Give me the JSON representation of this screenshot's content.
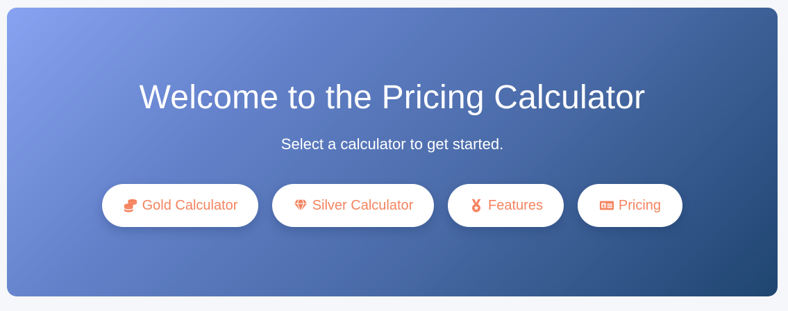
{
  "hero": {
    "title": "Welcome to the Pricing Calculator",
    "subtitle": "Select a calculator to get started."
  },
  "buttons": [
    {
      "label": "Gold Calculator",
      "icon": "coins-icon"
    },
    {
      "label": "Silver Calculator",
      "icon": "gem-icon"
    },
    {
      "label": "Features",
      "icon": "medal-icon"
    },
    {
      "label": "Pricing",
      "icon": "money-bill-icon"
    }
  ],
  "colors": {
    "accent": "#f4845f",
    "gradient_start": "#88a3f1",
    "gradient_end": "#1f4570",
    "button_bg": "#ffffff",
    "text": "#ffffff"
  }
}
